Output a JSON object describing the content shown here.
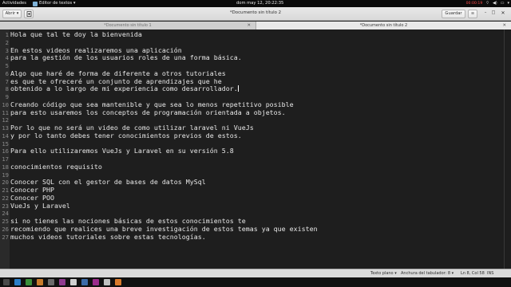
{
  "top_bar": {
    "activities": "Actividades",
    "app_name": "Editor de textos ▾",
    "clock": "dom may 12, 20:22:35",
    "recording": "00:00:19",
    "tray_icons": [
      "network-icon",
      "volume-icon",
      "battery-icon",
      "power-icon"
    ]
  },
  "header_bar": {
    "open_label": "Abrir ▾",
    "new_icon": "new-document-icon",
    "title": "*Documento sin título 2",
    "save_label": "Guardar",
    "menu_icon": "hamburger-menu-icon",
    "minimize": "–",
    "maximize": "□",
    "close": "✕"
  },
  "tabs": [
    {
      "label": "*Documento sin título 1",
      "active": false,
      "close": "✕"
    },
    {
      "label": "*Documento sin título 2",
      "active": true,
      "close": "✕"
    }
  ],
  "editor": {
    "lines": [
      {
        "num": "1",
        "text": "Hola que tal te doy la bienvenida"
      },
      {
        "num": "2",
        "text": ""
      },
      {
        "num": "3",
        "text": "En estos videos realizaremos una aplicación"
      },
      {
        "num": "4",
        "text": "para la gestión de los usuarios roles de una forma básica."
      },
      {
        "num": "5",
        "text": ""
      },
      {
        "num": "6",
        "text": "Algo que haré de forma de diferente a otros tutoriales"
      },
      {
        "num": "7",
        "text": "es que te ofreceré un conjunto de aprendizajes que he"
      },
      {
        "num": "8",
        "text": "obtenido a lo largo de mi experiencia como desarrollador."
      },
      {
        "num": "9",
        "text": ""
      },
      {
        "num": "10",
        "text": "Creando código que sea mantenible y que sea lo menos repetitivo posible"
      },
      {
        "num": "11",
        "text": "para esto usaremos los conceptos de programación orientada a objetos."
      },
      {
        "num": "12",
        "text": ""
      },
      {
        "num": "13",
        "text": "Por lo que no será un video de como utilizar laravel ni VueJs"
      },
      {
        "num": "14",
        "text": "y por lo tanto debes tener conocimientos previos de estos."
      },
      {
        "num": "15",
        "text": ""
      },
      {
        "num": "16",
        "text": "Para ello utilizaremos VueJs y Laravel en su versión 5.8"
      },
      {
        "num": "17",
        "text": ""
      },
      {
        "num": "18",
        "text": "conocimientos requisito"
      },
      {
        "num": "19",
        "text": ""
      },
      {
        "num": "20",
        "text": "Conocer SQL con el gestor de bases de datos MySql"
      },
      {
        "num": "21",
        "text": "Conocer PHP"
      },
      {
        "num": "22",
        "text": "Conocer POO"
      },
      {
        "num": "23",
        "text": "VueJs y Laravel"
      },
      {
        "num": "24",
        "text": ""
      },
      {
        "num": "25",
        "text": "si no tienes las nociones básicas de estos conocimientos te"
      },
      {
        "num": "26",
        "text": "recomiendo que realices una breve investigación de estos temas ya que existen"
      },
      {
        "num": "27",
        "text": "muchos videos tutoriales sobre estas tecnologías."
      }
    ],
    "current_line": 8
  },
  "status_bar": {
    "language": "Texto plano ▾",
    "tab_width": "Anchura del tabulador: 8 ▾",
    "position": "Ln 8, Col 58",
    "insert_mode": "INS"
  },
  "taskbar": {
    "launchers": [
      "files-icon",
      "browser-icon",
      "terminal-icon",
      "media-icon",
      "settings-icon",
      "graphics-icon",
      "documents-icon",
      "code-icon",
      "video-icon",
      "viewer-icon",
      "app-icon"
    ]
  },
  "colors": {
    "editor_bg": "#1e1e1e",
    "editor_text": "#e8e8e8",
    "gutter_bg": "#2a2a2a",
    "headerbar_bg": "#e3e3e3",
    "recording": "#ff4a4a"
  }
}
